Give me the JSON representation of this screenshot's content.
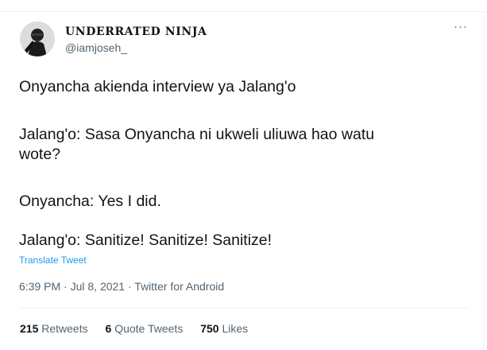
{
  "author": {
    "name": "UNDERRATED NINJA",
    "handle": "@iamjoseh_",
    "avatar_icon": "profile-avatar"
  },
  "more_icon": "ellipsis-icon",
  "more_label": "···",
  "tweet": {
    "lines": [
      "Onyancha akienda interview ya Jalang'o",
      "Jalang'o: Sasa Onyancha ni ukweli uliuwa hao watu",
      "wote?",
      "Onyancha: Yes I did.",
      "Jalang'o: Sanitize! Sanitize! Sanitize!"
    ]
  },
  "translate_label": "Translate Tweet",
  "meta": {
    "time": "6:39 PM",
    "separator1": " · ",
    "date": "Jul 8, 2021",
    "separator2": " · ",
    "source": "Twitter for Android"
  },
  "stats": {
    "retweets_count": "215",
    "retweets_label": "Retweets",
    "quotes_count": "6",
    "quotes_label": "Quote Tweets",
    "likes_count": "750",
    "likes_label": "Likes"
  },
  "colors": {
    "link": "#1d9bf0",
    "secondary": "#536471",
    "primary": "#0f1419"
  }
}
